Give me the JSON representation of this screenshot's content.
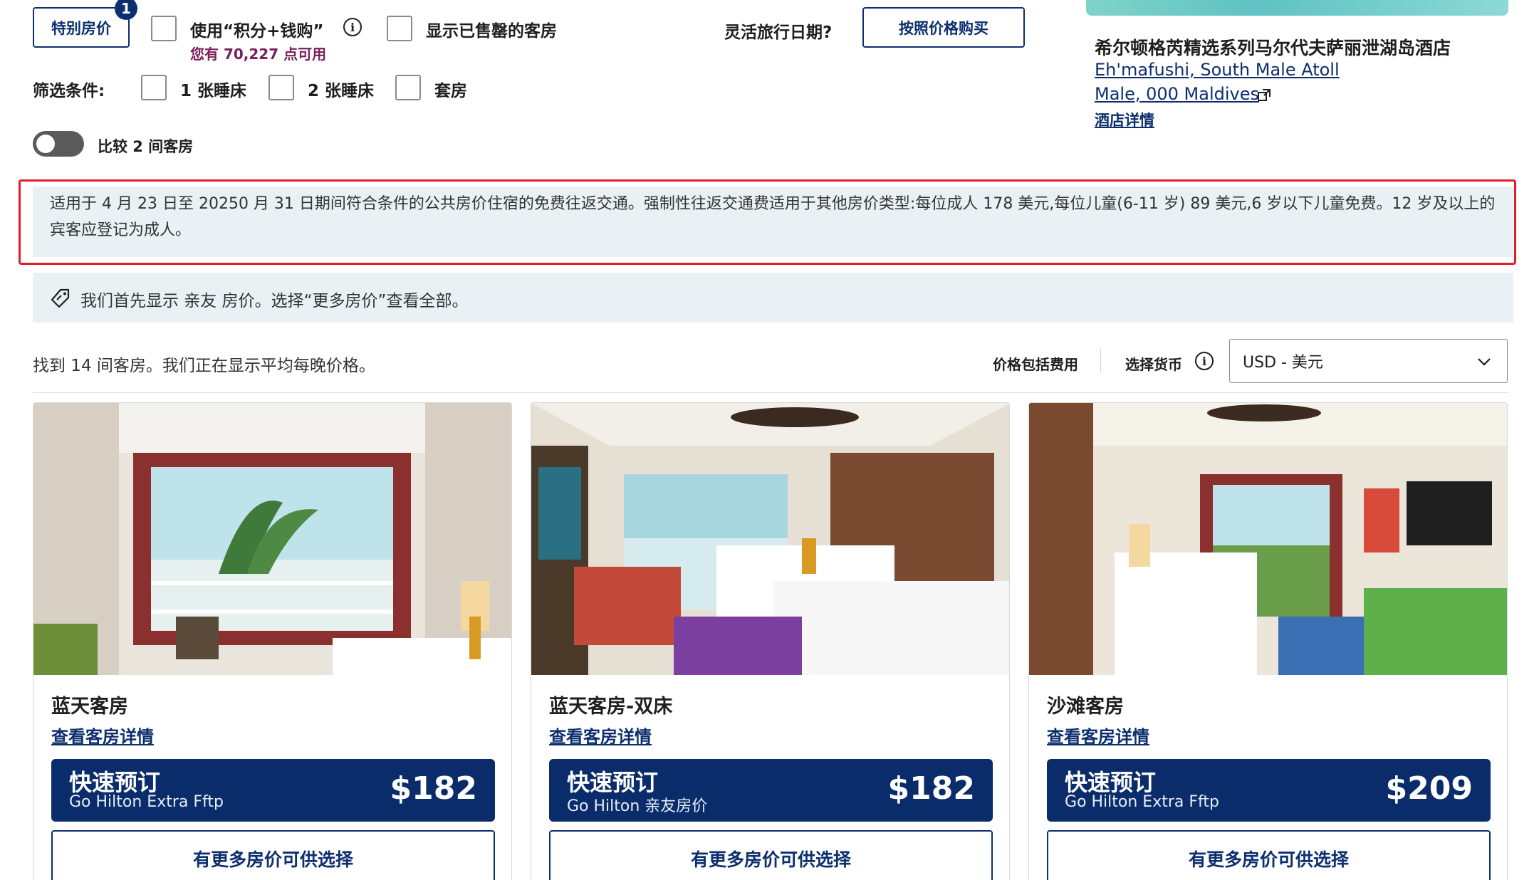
{
  "filters": {
    "special_rate_label": "特别房价",
    "special_rate_count": "1",
    "points_money_label": "使用“积分+钱购”",
    "points_available": "您有 70,227 点可用",
    "show_sold_out_label": "显示已售罄的客房",
    "flexible_dates_label": "灵活旅行日期?",
    "buy_by_price_label": "按照价格购买",
    "filter_by_label": "筛选条件:",
    "one_bed_label": "1 张睡床",
    "two_bed_label": "2 张睡床",
    "suite_label": "套房",
    "compare_label": "比较 2 间客房"
  },
  "hotel": {
    "name": "希尔顿格芮精选系列马尔代夫萨丽泄湖岛酒店",
    "address_line1": "Eh'mafushi, South Male Atoll",
    "address_line2": "Male, 000 Maldives",
    "details_link": "酒店详情"
  },
  "notice": {
    "transfer_text": "适用于 4 月 23 日至 20250 月 31 日期间符合条件的公共房价住宿的免费往返交通。强制性往返交通费适用于其他房价类型:每位成人 178 美元,每位儿童(6-11 岁) 89 美元,6 岁以下儿童免费。12 岁及以上的宾客应登记为成人。",
    "rate_text": "我们首先显示 亲友 房价。选择“更多房价”查看全部。"
  },
  "results": {
    "summary": "找到 14 间客房。我们正在显示平均每晚价格。",
    "price_incl_fees": "价格包括费用",
    "select_currency": "选择货币",
    "currency_value": "USD - 美元"
  },
  "rooms": [
    {
      "name": "蓝天客房",
      "details_link": "查看客房详情",
      "book_title": "快速预订",
      "rate_name": "Go Hilton Extra Fftp",
      "price": "$182",
      "more_rates": "有更多房价可供选择"
    },
    {
      "name": "蓝天客房-双床",
      "details_link": "查看客房详情",
      "book_title": "快速预订",
      "rate_name": "Go Hilton 亲友房价",
      "price": "$182",
      "more_rates": "有更多房价可供选择"
    },
    {
      "name": "沙滩客房",
      "details_link": "查看客房详情",
      "book_title": "快速预订",
      "rate_name": "Go Hilton Extra Fftp",
      "price": "$209",
      "more_rates": "有更多房价可供选择"
    }
  ],
  "colors": {
    "brand_navy": "#0a2c6a",
    "highlight_red": "#e11d2a",
    "points_purple": "#7a1f5c",
    "notice_bg": "#e9f1f5"
  }
}
